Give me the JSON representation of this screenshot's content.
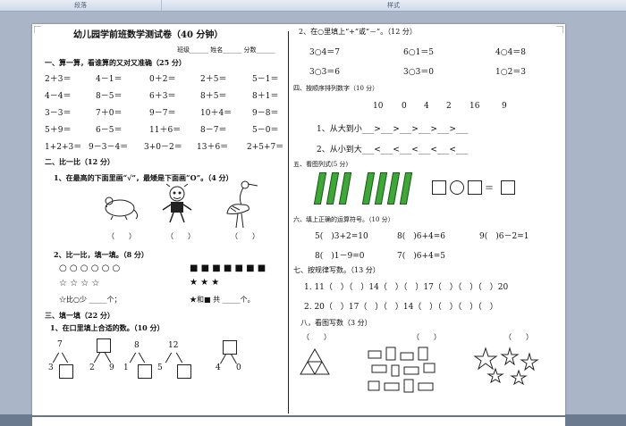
{
  "ribbon": {
    "group_paragraph": "段落",
    "group_style": "样式"
  },
  "doc": {
    "title": "幼儿园学前班数学测试卷（40 分钟）",
    "info": "班级______ 姓名______ 分数______",
    "s1": "一、算一算，看谁算的又对又准确（25 分）",
    "calc": [
      [
        "2＋3＝",
        "4－1＝",
        "0＋2＝",
        "2＋5＝",
        "5－1＝"
      ],
      [
        "4－4＝",
        "8－5＝",
        "6＋3＝",
        "8＋5＝",
        "8＋1＝"
      ],
      [
        "3－3＝",
        "7＋0＝",
        "9－7＝",
        "10＋4＝",
        "9－8＝"
      ],
      [
        "5＋9＝",
        "6－5＝",
        "11＋6＝",
        "8－7＝",
        "5－0＝"
      ],
      [
        "1+2+3＝",
        "9－3－4＝",
        "3+0－2＝",
        "13＋6＝",
        "2+5+7＝"
      ]
    ],
    "s2": "二、比一比（12 分）",
    "s2q1": "1、在最高的下面里画“√”，最矮是下面画“O”。（4 分）",
    "paren": "（　　）",
    "s2q2": "2、比一比，填一填。（8 分）",
    "circles": "○ ○ ○ ○ ○ ○",
    "stars": "☆ ☆ ☆ ☆",
    "squares": "■ ■ ■ ■ ■ ■ ■",
    "bstars": "★ ★ ★",
    "cmp1": "☆比○少 _____个；",
    "cmp2": "★和■ 共 _____个。",
    "s3": "三、填一填（22 分）",
    "s3q1": "1、在口里填上合适的数。（10 分）",
    "decomp": [
      {
        "top": "7",
        "left": "3",
        "right": ""
      },
      {
        "top": "",
        "left": "2",
        "right": "9"
      },
      {
        "top": "8",
        "left": "1",
        "right": ""
      },
      {
        "top": "12",
        "left": "5",
        "right": ""
      },
      {
        "top": "",
        "left": "4",
        "right": "0"
      }
    ],
    "r_q2": "2、在○里填上“+”或“－”。（12 分）",
    "ops": [
      [
        "3○4＝7",
        "6○1＝5",
        "4○4＝8"
      ],
      [
        "3○3＝6",
        "3○3＝0",
        "1○2＝3"
      ]
    ],
    "r_s4": "四、按顺序排列数字（10 分）",
    "nums": [
      "10",
      "0",
      "4",
      "2",
      "16",
      "9"
    ],
    "r_big": "1、从大到小___>___>___>___>___>___",
    "r_small": "2、从小到大___<___<___<___<___<___",
    "r_s5": "五、看图列式(5 分)",
    "eq_sign": "＝",
    "r_s6": "六、填上正确的运算符号。（10 分）",
    "ops2": [
      [
        "5(　)3+2=10",
        "8(　)6+4=6",
        "9(　)6－2=1"
      ],
      [
        "8(　)1－9=0",
        "7(　)6+4=5"
      ]
    ],
    "r_s7": "七、按规律写数。（13 分）",
    "seq1": "1. 11（　）（　）14（　）（　）17（　）（　）（　）20",
    "seq2": "2. 20（　）17（　）（　）14（　）（　）（　）（　）",
    "r_s8": "八，看图写数（3 分）",
    "paren2": "（　　）"
  }
}
